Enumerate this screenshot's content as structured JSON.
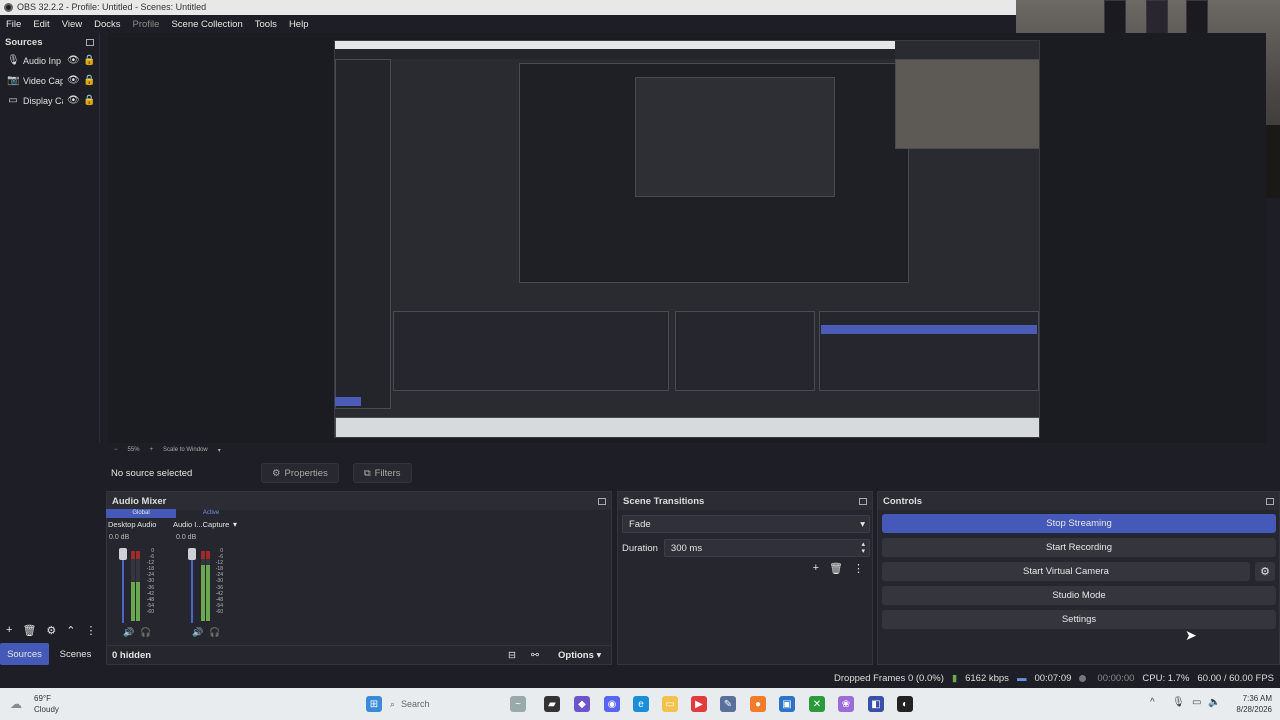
{
  "window": {
    "title": "OBS 32.2.2 - Profile: Untitled - Scenes: Untitled"
  },
  "menu": [
    "File",
    "Edit",
    "View",
    "Docks",
    "Profile",
    "Scene Collection",
    "Tools",
    "Help"
  ],
  "sources_dock": {
    "title": "Sources",
    "items": [
      {
        "label": "Audio Inp",
        "icon": "microphone-icon"
      },
      {
        "label": "Video Cap",
        "icon": "camera-icon"
      },
      {
        "label": "Display Ca",
        "icon": "monitor-icon"
      }
    ],
    "tabs": [
      "Sources",
      "Scenes"
    ]
  },
  "zoom": {
    "level": "55%",
    "mode": "Scale to Window"
  },
  "context": {
    "no_source": "No source selected",
    "properties": "Properties",
    "filters": "Filters"
  },
  "mixer": {
    "title": "Audio Mixer",
    "tabs": [
      "Global",
      "Active"
    ],
    "channels": [
      {
        "name": "Desktop Audio",
        "db": "0.0 dB",
        "level": 0.55
      },
      {
        "name": "Audio I...Capture",
        "db": "0.0 dB",
        "level": 0.8
      }
    ],
    "scale": [
      "0",
      "-6",
      "-12",
      "-18",
      "-24",
      "-30",
      "-36",
      "-42",
      "-48",
      "-54",
      "-60"
    ],
    "hidden": "0 hidden",
    "options": "Options"
  },
  "transitions": {
    "title": "Scene Transitions",
    "selected": "Fade",
    "duration_label": "Duration",
    "duration_value": "300 ms"
  },
  "controls": {
    "title": "Controls",
    "buttons": [
      "Stop Streaming",
      "Start Recording",
      "Start Virtual Camera",
      "Studio Mode",
      "Settings"
    ]
  },
  "status": {
    "dropped": "Dropped Frames 0 (0.0%)",
    "bitrate": "6162 kbps",
    "stream_time": "00:07:09",
    "rec_time": "00:00:00",
    "cpu": "CPU: 1.7%",
    "fps": "60.00 / 60.00 FPS"
  },
  "taskbar": {
    "weather_temp": "69°F",
    "weather_desc": "Cloudy",
    "search": "Search",
    "time": "7:36 AM",
    "date": "8/28/2026"
  },
  "colors": {
    "accent": "#4459b8",
    "bg": "#1e1f26",
    "panel": "#25262e"
  }
}
